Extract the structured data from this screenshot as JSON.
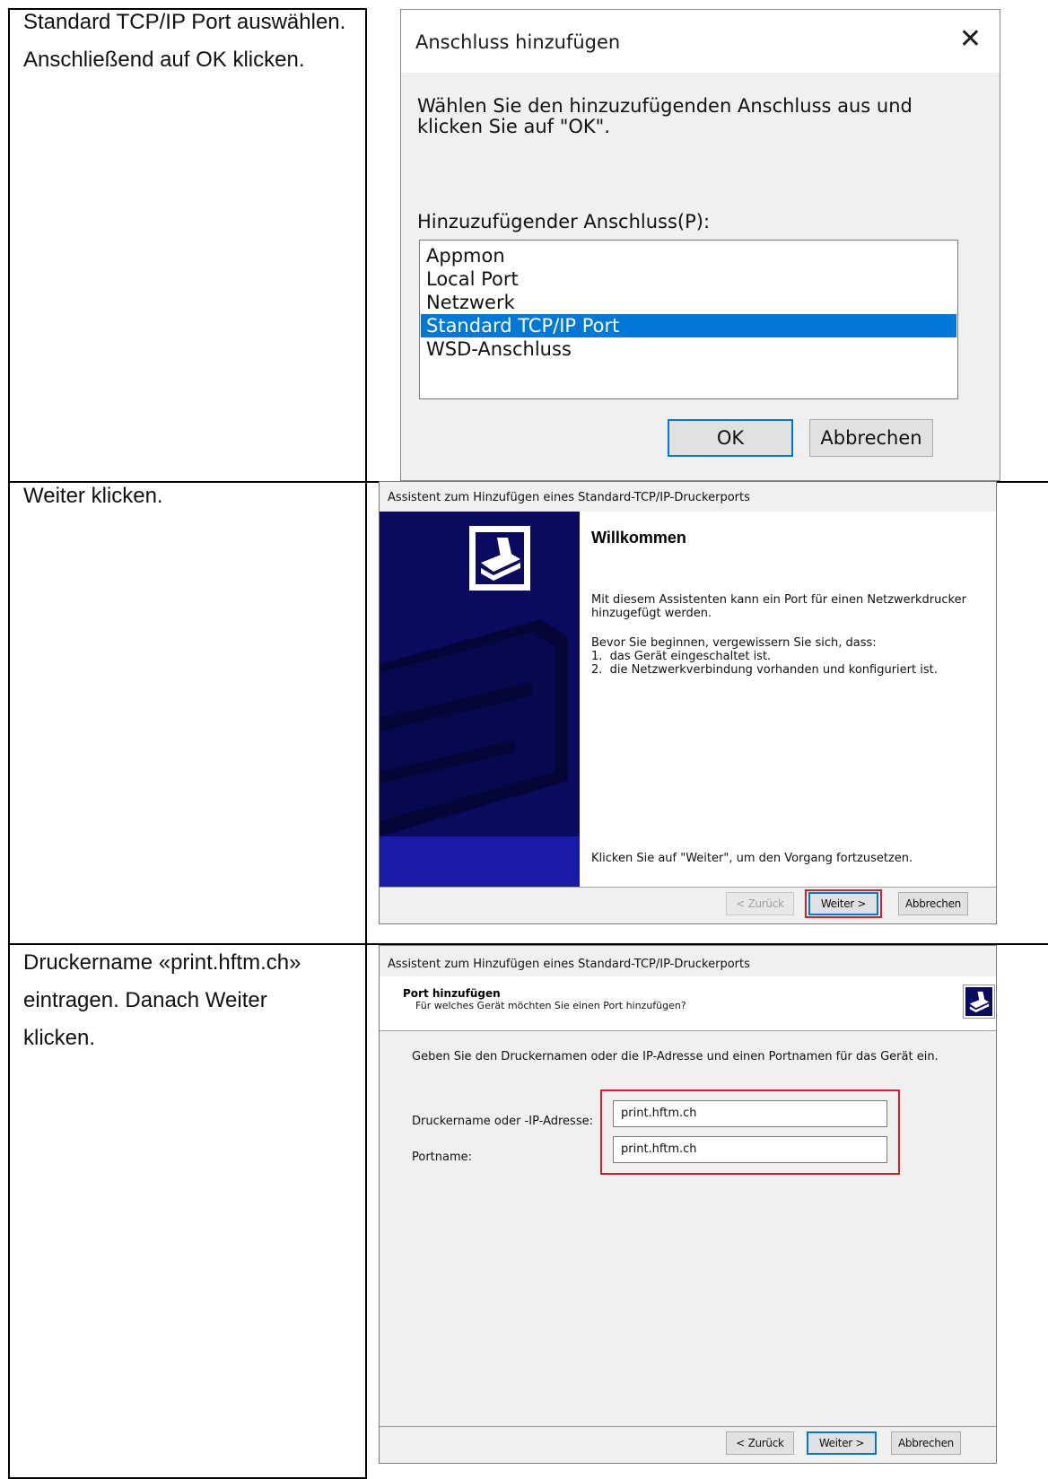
{
  "rows": [
    {
      "instruction": "Standard TCP/IP Port auswählen. Anschließend auf OK klicken."
    },
    {
      "instruction": "Weiter klicken."
    },
    {
      "instruction": "Druckername «print.hftm.ch» eintragen. Danach Weiter klicken."
    }
  ],
  "dialog1": {
    "title": "Anschluss hinzufügen",
    "close": "✕",
    "description": "Wählen Sie den hinzuzufügenden Anschluss aus und klicken Sie auf \"OK\".",
    "list_label": "Hinzuzufügender Anschluss(P):",
    "items": [
      "Appmon",
      "Local Port",
      "Netzwerk",
      "Standard TCP/IP Port",
      "WSD-Anschluss"
    ],
    "selected_item": "Standard TCP/IP Port",
    "ok": "OK",
    "cancel": "Abbrechen"
  },
  "wizard1": {
    "title": "Assistent zum Hinzufügen eines Standard-TCP/IP-Druckerports",
    "heading": "Willkommen",
    "intro": "Mit diesem Assistenten kann ein Port für einen Netzwerkdrucker hinzugefügt werden.",
    "before": "Bevor Sie beginnen, vergewissern Sie sich, dass:",
    "point1": "1.  das Gerät eingeschaltet ist.",
    "point2": "2.  die Netzwerkverbindung vorhanden und konfiguriert ist.",
    "continue": "Klicken Sie auf \"Weiter\", um den Vorgang fortzusetzen.",
    "back": "< Zurück",
    "next": "Weiter >",
    "cancel": "Abbrechen"
  },
  "wizard2": {
    "title": "Assistent zum Hinzufügen eines Standard-TCP/IP-Druckerports",
    "header": "Port hinzufügen",
    "subheader": "Für welches Gerät möchten Sie einen Port hinzufügen?",
    "instruction": "Geben Sie den Druckernamen oder die IP-Adresse und einen Portnamen für das Gerät ein.",
    "printer_label": "Druckername oder -IP-Adresse:",
    "printer_value": "print.hftm.ch",
    "port_label": "Portname:",
    "port_value": "print.hftm.ch",
    "back": "< Zurück",
    "next": "Weiter >",
    "cancel": "Abbrechen"
  },
  "icons": {
    "wizard_icon": "printer-icon"
  },
  "colors": {
    "selection": "#0078d7",
    "highlight": "#d21f2a",
    "sidebar": "#0a0a5e"
  }
}
